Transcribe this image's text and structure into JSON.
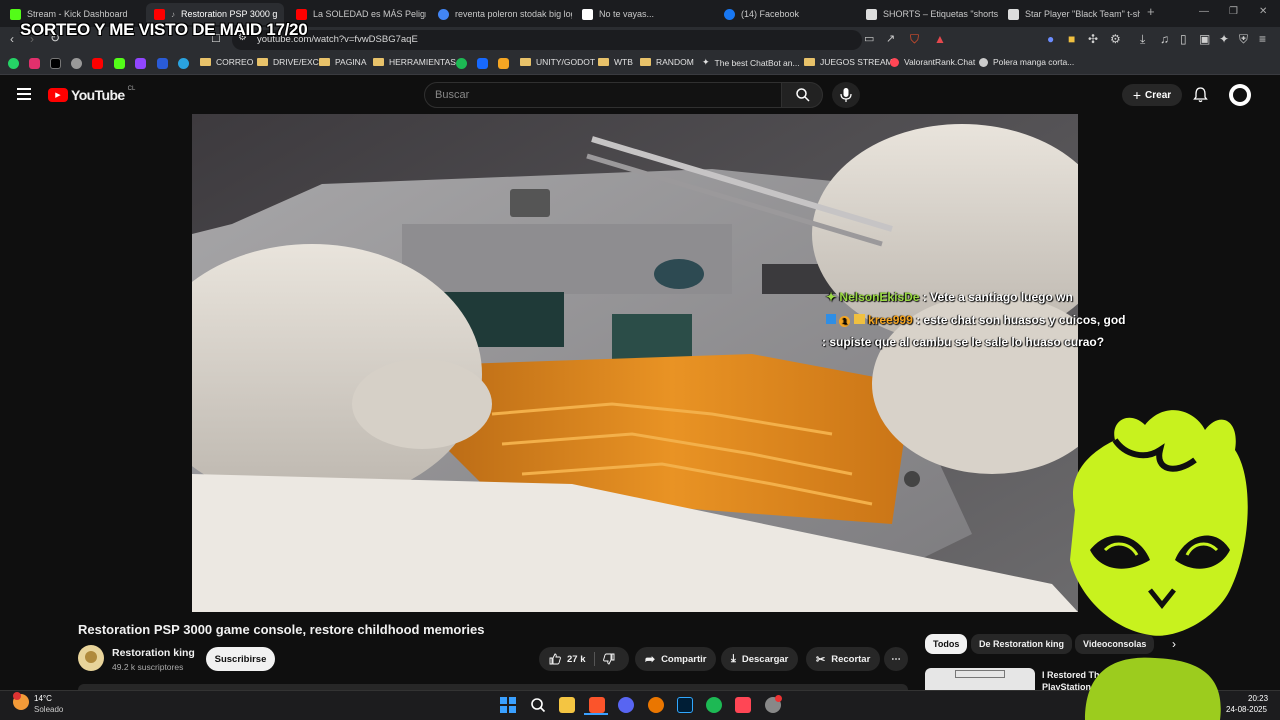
{
  "overlay": {
    "title": "SORTEO Y ME VISTO DE MAID 17/20"
  },
  "browser": {
    "tabs": [
      {
        "label": "Stream - Kick Dashboard",
        "icon": "kick-icon",
        "color": "#53fc18"
      },
      {
        "label": "Restoration PSP 3000 g",
        "icon": "youtube-icon",
        "color": "#ff0000"
      },
      {
        "label": "La SOLEDAD es MÁS Peligrosa",
        "icon": "youtube-icon",
        "color": "#ff0000"
      },
      {
        "label": "reventa poleron stodak big log",
        "icon": "google-icon",
        "color": "#4285f4"
      },
      {
        "label": "No te vayas...",
        "icon": "notion-icon",
        "color": "#ffffff"
      },
      {
        "label": "(14) Facebook",
        "icon": "facebook-icon",
        "color": "#1877f2"
      },
      {
        "label": "SHORTS – Etiquetas \"shorts\" –",
        "icon": "page-icon",
        "color": "#dddddd"
      },
      {
        "label": "Star Player \"Black Team\" t-shirt",
        "icon": "star-icon",
        "color": "#dddddd"
      }
    ],
    "url": "youtube.com/watch?v=fvwDSBG7aqE",
    "bookmarks": [
      {
        "label": "CORREO"
      },
      {
        "label": "DRIVE/EXC"
      },
      {
        "label": "PAGINA"
      },
      {
        "label": "HERRAMIENTAS"
      },
      {
        "label": "UNITY/GODOT"
      },
      {
        "label": "WTB"
      },
      {
        "label": "RANDOM"
      },
      {
        "label": "The best ChatBot an..."
      },
      {
        "label": "JUEGOS STREAM"
      },
      {
        "label": "ValorantRank.Chat"
      },
      {
        "label": "Polera manga corta..."
      }
    ]
  },
  "youtube": {
    "logo": "YouTube",
    "region": "CL",
    "search_placeholder": "Buscar",
    "create_label": "Crear",
    "chat": [
      {
        "user": "NelsonEkisDe",
        "text": ": Vete a santiago luego wn"
      },
      {
        "user": "kree999",
        "badge": "1",
        "text": ": este chat son huasos y cuicos, god"
      },
      {
        "user": "",
        "text": ": supiste que al cambu se le sale lo huaso curao?"
      }
    ],
    "video_title": "Restoration PSP 3000 game console, restore childhood memories",
    "channel_name": "Restoration king",
    "subscribers": "49.2 k suscriptores",
    "subscribe_label": "Suscribirse",
    "likes": "27 k",
    "share_label": "Compartir",
    "download_label": "Descargar",
    "clip_label": "Recortar",
    "chips": [
      "Todos",
      "De Restoration king",
      "Videoconsolas"
    ],
    "recommended_title": "I Restored Th PlayStation"
  },
  "taskbar": {
    "temperature": "14°C",
    "weather": "Soleado",
    "time": "20:23",
    "date": "24-08-2025"
  }
}
